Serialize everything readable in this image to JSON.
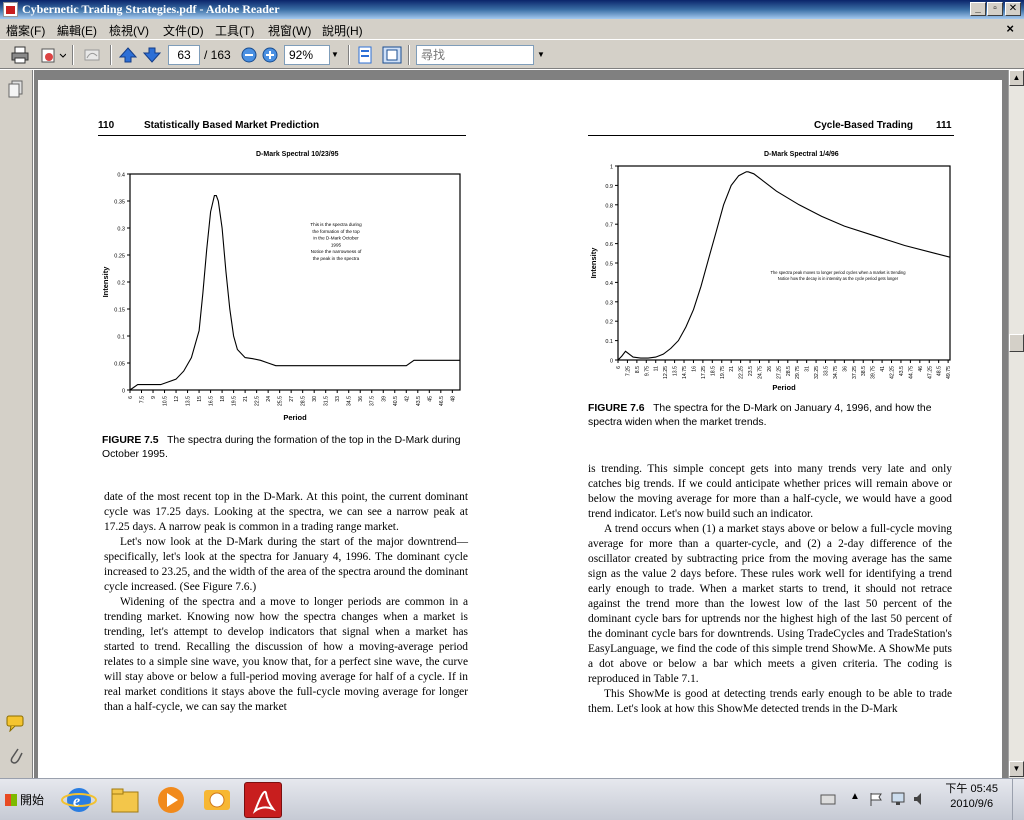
{
  "window": {
    "title": "Cybernetic Trading Strategies.pdf - Adobe Reader",
    "min": "_",
    "max": "▫",
    "close": "✕"
  },
  "menu": [
    "檔案(F)",
    "編輯(E)",
    "檢視(V)",
    "文件(D)",
    "工具(T)",
    "視窗(W)",
    "說明(H)"
  ],
  "doc_close": "×",
  "toolbar": {
    "page_current": "63",
    "page_total": "/ 163",
    "zoom": "92%",
    "search_placeholder": "尋找"
  },
  "left_page": {
    "folio": "110",
    "running_head": "Statistically Based Market Prediction",
    "figure_caption_label": "FIGURE 7.5",
    "figure_caption_text": "The spectra during the formation of the top in the D-Mark during October 1995.",
    "body": [
      "date of the most recent top in the D-Mark. At this point, the current dominant cycle was 17.25 days. Looking at the spectra, we can see a narrow peak at 17.25 days. A narrow peak is common in a trading range market.",
      "Let's now look at the D-Mark during the start of the major downtrend—specifically, let's look at the spectra for January 4, 1996. The dominant cycle increased to 23.25, and the width of the area of the spectra around the dominant cycle increased. (See Figure 7.6.)",
      "Widening of the spectra and a move to longer periods are common in a trending market. Knowing now how the spectra changes when a market is trending, let's attempt to develop indicators that signal when a market has started to trend. Recalling the discussion of how a moving-average period relates to a simple sine wave, you know that, for a perfect sine wave, the curve will stay above or below a full-period moving average for half of a cycle. If in real market conditions it stays above the full-cycle moving average for longer than a half-cycle, we can say the market"
    ]
  },
  "right_page": {
    "folio": "111",
    "running_head": "Cycle-Based Trading",
    "figure_caption_label": "FIGURE 7.6",
    "figure_caption_text": "The spectra for the D-Mark on January 4, 1996, and how the spectra widen when the market trends.",
    "body": [
      "is trending. This simple concept gets into many trends very late and only catches big trends. If we could anticipate whether prices will remain above or below the moving average for more than a half-cycle, we would have a good trend indicator. Let's now build such an indicator.",
      "A trend occurs when (1) a market stays above or below a full-cycle moving average for more than a quarter-cycle, and (2) a 2-day difference of the oscillator created by subtracting price from the moving average has the same sign as the value 2 days before. These rules work well for identifying a trend early enough to trade. When a market starts to trend, it should not retrace against the trend more than the lowest low of the last 50 percent of the dominant cycle bars for uptrends nor the highest high of the last 50 percent of the dominant cycle bars for downtrends. Using TradeCycles and TradeStation's EasyLanguage, we find the code of this simple trend ShowMe. A ShowMe puts a dot above or below a bar which meets a given criteria. The coding is reproduced in Table 7.1.",
      "This ShowMe is good at detecting trends early enough to be able to trade them. Let's look at how this ShowMe detected trends in the D-Mark"
    ]
  },
  "chart_data": [
    {
      "type": "line",
      "title": "D-Mark Spectral 10/23/95",
      "xlabel": "Period",
      "ylabel": "Intensity",
      "annotation": [
        "This is the spectra during",
        "the formation of the top",
        "in the D-Mark October",
        "1995",
        "Notice the narrowness of",
        "the peak in the spectra"
      ],
      "x_ticks": [
        "6",
        "7.5",
        "9",
        "10.5",
        "12",
        "13.5",
        "15",
        "16.5",
        "18",
        "19.5",
        "21",
        "22.5",
        "24",
        "25.5",
        "27",
        "28.5",
        "30",
        "31.5",
        "33",
        "34.5",
        "36",
        "37.5",
        "39",
        "40.5",
        "42",
        "43.5",
        "45",
        "46.5",
        "48"
      ],
      "y_ticks": [
        "0",
        "0.05",
        "0.1",
        "0.15",
        "0.2",
        "0.25",
        "0.3",
        "0.35",
        "0.4"
      ],
      "ylim": [
        0,
        0.4
      ],
      "xlim": [
        6,
        49
      ],
      "x": [
        6,
        7,
        9,
        10,
        11,
        12,
        13,
        14,
        15,
        15.5,
        16,
        16.5,
        17,
        17.25,
        17.5,
        18,
        18.5,
        19,
        19.5,
        20,
        21,
        22,
        23,
        24,
        25,
        27,
        30,
        36,
        42,
        43,
        49
      ],
      "y": [
        0,
        0.01,
        0.01,
        0.01,
        0.015,
        0.02,
        0.035,
        0.06,
        0.11,
        0.18,
        0.26,
        0.33,
        0.36,
        0.36,
        0.35,
        0.3,
        0.22,
        0.15,
        0.1,
        0.075,
        0.06,
        0.058,
        0.055,
        0.05,
        0.045,
        0.045,
        0.045,
        0.045,
        0.045,
        0.055,
        0.055
      ]
    },
    {
      "type": "line",
      "title": "D-Mark Spectral 1/4/96",
      "xlabel": "Period",
      "ylabel": "Intensity",
      "annotation": [
        "The spectra peak moves to longer period cycles when a market is trending",
        "Notice how the decay is in intensity as the cycle period gets longer"
      ],
      "x_ticks": [
        "6",
        "7.25",
        "8.5",
        "9.75",
        "11",
        "12.25",
        "13.5",
        "14.75",
        "16",
        "17.25",
        "18.5",
        "19.75",
        "21",
        "22.25",
        "23.5",
        "24.75",
        "26",
        "27.25",
        "28.5",
        "29.75",
        "31",
        "32.25",
        "33.5",
        "34.75",
        "36",
        "37.25",
        "38.5",
        "39.75",
        "41",
        "42.25",
        "43.5",
        "44.75",
        "46",
        "47.25",
        "48.5",
        "49.75"
      ],
      "y_ticks": [
        "0",
        "0.1",
        "0.2",
        "0.3",
        "0.4",
        "0.5",
        "0.6",
        "0.7",
        "0.8",
        "0.9",
        "1"
      ],
      "ylim": [
        0,
        1
      ],
      "xlim": [
        6,
        50
      ],
      "x": [
        6,
        6.5,
        7,
        7.5,
        8,
        9,
        10,
        11,
        12,
        13,
        14,
        15,
        16,
        17,
        18,
        19,
        20,
        21,
        22,
        23,
        23.25,
        24,
        25,
        27,
        30,
        33,
        36,
        40,
        44,
        48,
        50
      ],
      "y": [
        0,
        0.02,
        0.045,
        0.03,
        0.015,
        0.01,
        0.01,
        0.015,
        0.03,
        0.06,
        0.1,
        0.17,
        0.26,
        0.38,
        0.52,
        0.66,
        0.8,
        0.9,
        0.95,
        0.97,
        0.97,
        0.96,
        0.93,
        0.87,
        0.8,
        0.74,
        0.69,
        0.64,
        0.59,
        0.55,
        0.53
      ]
    }
  ],
  "taskbar": {
    "start_label": "開始",
    "clock_time": "下午 05:45",
    "clock_date": "2010/9/6"
  },
  "colors": {
    "titlebar": "#0a246a",
    "chrome": "#d4d0c8",
    "doc_bg": "#808080",
    "acrobat_red": "#c81e1e"
  }
}
